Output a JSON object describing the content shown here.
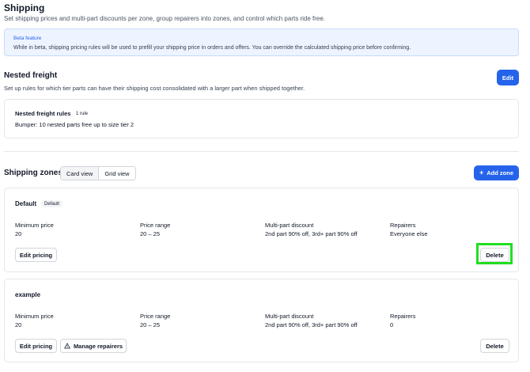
{
  "page": {
    "title": "Shipping",
    "subtitle": "Set shipping prices and multi-part discounts per zone, group repairers into zones, and control which parts ride free."
  },
  "beta": {
    "title": "Beta feature",
    "text": "While in beta, shipping pricing rules will be used to prefill your shipping price in orders and offers. You can override the calculated shipping price before confirming."
  },
  "nested_freight": {
    "title": "Nested freight",
    "description": "Set up rules for which tier parts can have their shipping cost consolidated with a larger part when shipped together.",
    "edit_label": "Edit",
    "rules_title": "Nested freight rules",
    "rules_count": "1 rule",
    "rule_text": "Bumper: 10 nested parts free up to size tier 2"
  },
  "zones": {
    "title": "Shipping zones",
    "views": [
      "Card view",
      "Grid view"
    ],
    "add_label": "Add zone",
    "columns": [
      "Minimum price",
      "Price range",
      "Multi-part discount",
      "Repairers"
    ],
    "items": [
      {
        "name": "Default",
        "badge": "Default",
        "values": [
          "20",
          "20 – 25",
          "2nd part 90% off, 3rd+ part 90% off",
          "Everyone else"
        ],
        "edit_label": "Edit pricing",
        "delete_label": "Delete"
      },
      {
        "name": "example",
        "values": [
          "20",
          "20 – 25",
          "2nd part 90% off, 3rd+ part 90% off",
          "0"
        ],
        "edit_label": "Edit pricing",
        "manage_label": "Manage repairers",
        "delete_label": "Delete"
      }
    ]
  },
  "colors": {
    "primary": "#2563eb",
    "highlight": "#22dd22",
    "beta_bg": "#eef4ff"
  },
  "icons": {
    "add": "plus-icon",
    "manage": "warning-triangle-icon"
  }
}
